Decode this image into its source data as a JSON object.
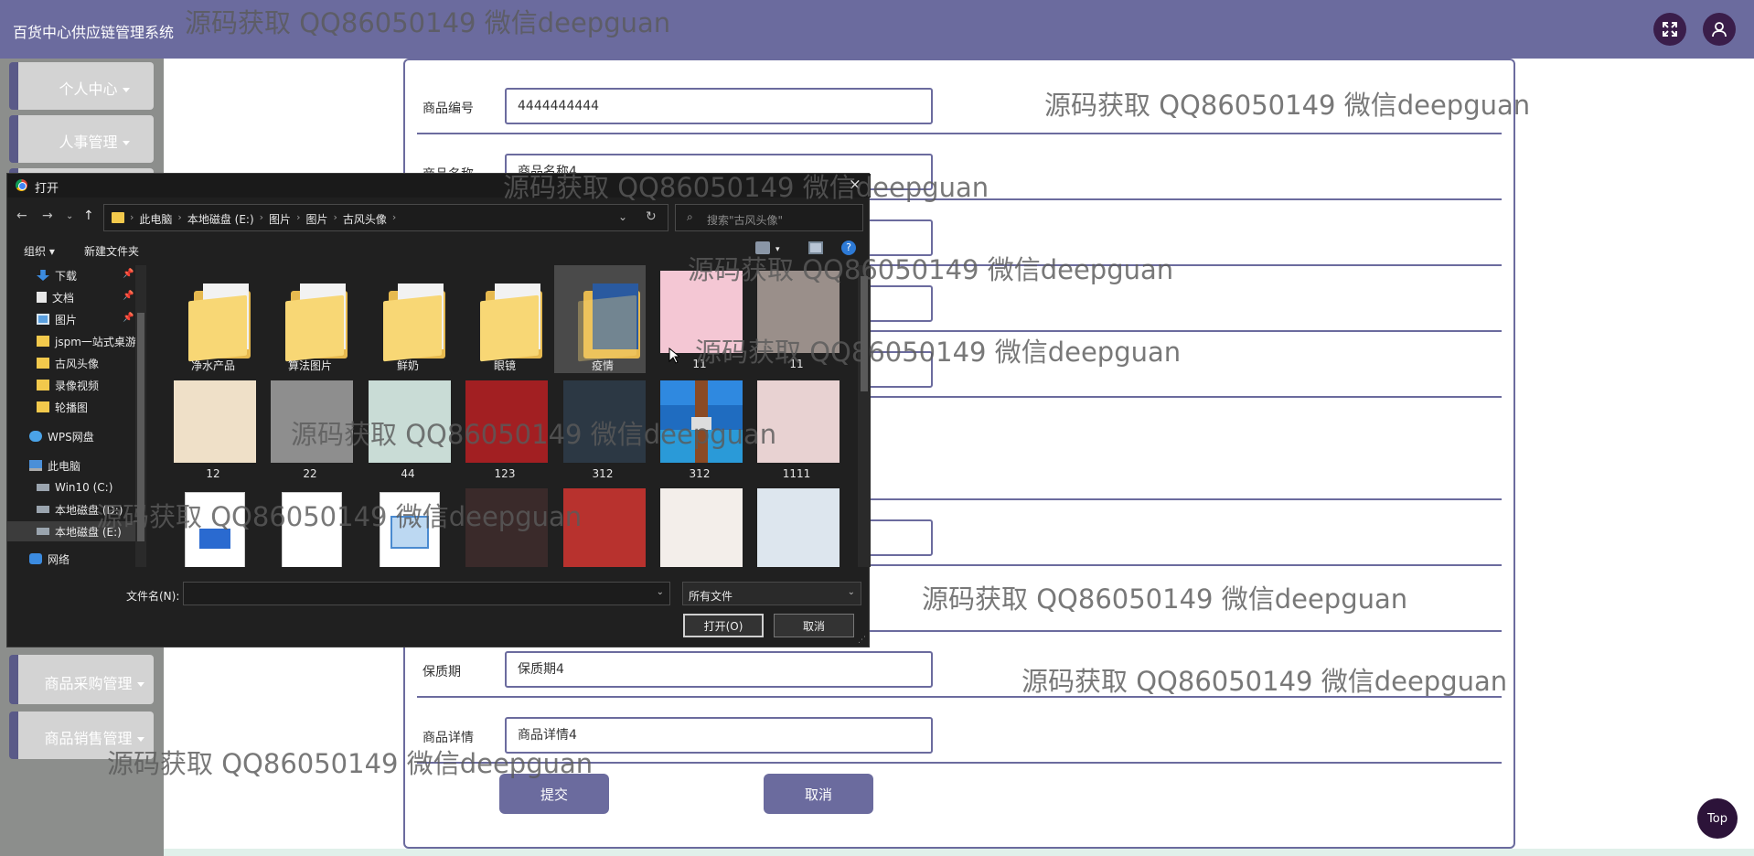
{
  "header": {
    "title": "百货中心供应链管理系统",
    "fullscreen_icon": "expand-icon",
    "user_icon": "user-icon"
  },
  "sidebar": {
    "items": [
      {
        "label": "个人中心"
      },
      {
        "label": "人事管理"
      },
      {
        "label": "商品采购管理"
      },
      {
        "label": "商品销售管理"
      }
    ]
  },
  "form": {
    "fields": [
      {
        "label": "商品编号",
        "value": "4444444444"
      },
      {
        "label": "商品名称",
        "value": "商品名称4"
      },
      {
        "label": "保质期",
        "value": "保质期4"
      },
      {
        "label": "商品详情",
        "value": "商品详情4"
      }
    ],
    "submit_label": "提交",
    "cancel_label": "取消"
  },
  "top_button": "Top",
  "watermark": "源码获取 QQ86050149 微信deepguan",
  "dialog": {
    "title": "打开",
    "close": "×",
    "breadcrumbs": [
      "此电脑",
      "本地磁盘 (E:)",
      "图片",
      "图片",
      "古风头像"
    ],
    "search_placeholder": "搜索\"古风头像\"",
    "toolbar": {
      "organize": "组织 ▾",
      "new_folder": "新建文件夹"
    },
    "nav_items": [
      {
        "label": "下载",
        "icon": "download-icon",
        "pinned": true
      },
      {
        "label": "文档",
        "icon": "document-icon",
        "pinned": true
      },
      {
        "label": "图片",
        "icon": "picture-icon",
        "pinned": true
      },
      {
        "label": "jspm一站式桌游",
        "icon": "folder-icon"
      },
      {
        "label": "古风头像",
        "icon": "folder-icon"
      },
      {
        "label": "录像视频",
        "icon": "folder-icon"
      },
      {
        "label": "轮播图",
        "icon": "folder-icon"
      },
      {
        "label": "WPS网盘",
        "icon": "cloud-icon"
      },
      {
        "label": "此电脑",
        "icon": "computer-icon"
      },
      {
        "label": "Win10 (C:)",
        "icon": "drive-icon"
      },
      {
        "label": "本地磁盘 (D:)",
        "icon": "drive-icon"
      },
      {
        "label": "本地磁盘 (E:)",
        "icon": "drive-icon",
        "selected": true
      },
      {
        "label": "网络",
        "icon": "network-icon"
      }
    ],
    "files": [
      {
        "name": "净水产品",
        "kind": "folder"
      },
      {
        "name": "算法图片",
        "kind": "folder"
      },
      {
        "name": "鲜奶",
        "kind": "folder"
      },
      {
        "name": "眼镜",
        "kind": "folder"
      },
      {
        "name": "疫情",
        "kind": "folder",
        "selected": true
      },
      {
        "name": "11",
        "kind": "image",
        "color": "#f4c7d4"
      },
      {
        "name": "11",
        "kind": "image",
        "color": "#9a8f8a"
      },
      {
        "name": "12",
        "kind": "image",
        "color": "#efe0c8"
      },
      {
        "name": "22",
        "kind": "image",
        "color": "#8e8e8e"
      },
      {
        "name": "44",
        "kind": "image",
        "color": "#c9dcd6"
      },
      {
        "name": "123",
        "kind": "image",
        "color": "#a21f22"
      },
      {
        "name": "312",
        "kind": "image",
        "color": "#2c3844"
      },
      {
        "name": "312",
        "kind": "archive",
        "color": "#2e7dd7"
      },
      {
        "name": "1111",
        "kind": "image",
        "color": "#e8d2d2"
      },
      {
        "name": "",
        "kind": "video",
        "color": "#ffffff"
      },
      {
        "name": "",
        "kind": "text",
        "color": "#ffffff"
      },
      {
        "name": "",
        "kind": "picture-file",
        "color": "#ffffff"
      },
      {
        "name": "",
        "kind": "image",
        "color": "#3a2a2a"
      },
      {
        "name": "",
        "kind": "image",
        "color": "#b8322e"
      },
      {
        "name": "",
        "kind": "image",
        "color": "#f3eeea"
      },
      {
        "name": "",
        "kind": "image",
        "color": "#dde6ee"
      }
    ],
    "filename_label": "文件名(N):",
    "filename_value": "",
    "filter_value": "所有文件",
    "open_label": "打开(O)",
    "cancel_label": "取消"
  },
  "colors": {
    "accent": "#6b6b9e",
    "sidebar_bg": "#8c8e8c",
    "dialog_bg": "#202020"
  }
}
